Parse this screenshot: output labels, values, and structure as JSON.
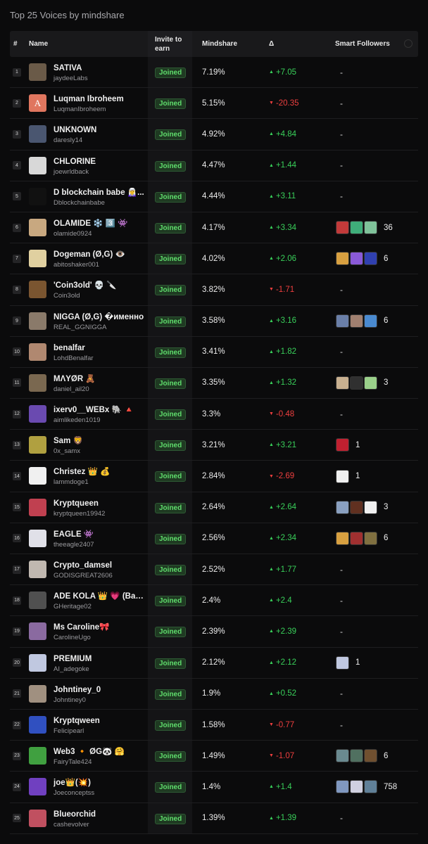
{
  "page_title": "Top 25 Voices by mindshare",
  "headers": {
    "rank": "#",
    "name": "Name",
    "invite": "Invite to earn",
    "mindshare": "Mindshare",
    "delta": "Δ",
    "smart": "Smart Followers"
  },
  "rows": [
    {
      "rank": "1",
      "name": "SATIVA",
      "handle": "jaydeeLabs",
      "status": "Joined",
      "mindshare": "7.19%",
      "delta": "+7.05",
      "dir": "up",
      "smart_count": "-",
      "sf_colors": [],
      "av": "#6a5a48"
    },
    {
      "rank": "2",
      "name": "Luqman Ibroheem",
      "handle": "LuqmanIbroheem",
      "status": "Joined",
      "mindshare": "5.15%",
      "delta": "-20.35",
      "dir": "down",
      "smart_count": "-",
      "sf_colors": [],
      "av": "#e0765f",
      "av_text": "A"
    },
    {
      "rank": "3",
      "name": "UNKNOWN",
      "handle": "daresly14",
      "status": "Joined",
      "mindshare": "4.92%",
      "delta": "+4.84",
      "dir": "up",
      "smart_count": "-",
      "sf_colors": [],
      "av": "#4a5670"
    },
    {
      "rank": "4",
      "name": "CHLORINE",
      "handle": "joewrldback",
      "status": "Joined",
      "mindshare": "4.47%",
      "delta": "+1.44",
      "dir": "up",
      "smart_count": "-",
      "sf_colors": [],
      "av": "#d8d8d8"
    },
    {
      "rank": "5",
      "name": "D blockchain babe 🧝‍♀️...",
      "handle": "Dblockchainbabe",
      "status": "Joined",
      "mindshare": "4.44%",
      "delta": "+3.11",
      "dir": "up",
      "smart_count": "-",
      "sf_colors": [],
      "av": "#111111"
    },
    {
      "rank": "6",
      "name": "OLAMIDE ❄️ 3️⃣ 👾",
      "handle": "olamide0924",
      "status": "Joined",
      "mindshare": "4.17%",
      "delta": "+3.34",
      "dir": "up",
      "smart_count": "36",
      "sf_colors": [
        "#c23a3a",
        "#3fae7a",
        "#7fc29a"
      ],
      "av": "#c8a880"
    },
    {
      "rank": "7",
      "name": "Dogeman (Ø,G) 👁️",
      "handle": "abitoshaker001",
      "status": "Joined",
      "mindshare": "4.02%",
      "delta": "+2.06",
      "dir": "up",
      "smart_count": "6",
      "sf_colors": [
        "#d8a040",
        "#8a5ad8",
        "#3040b0"
      ],
      "av": "#e0d0a0"
    },
    {
      "rank": "8",
      "name": "'Coin3old' 💀 🔪",
      "handle": "Coin3old",
      "status": "Joined",
      "mindshare": "3.82%",
      "delta": "-1.71",
      "dir": "down",
      "smart_count": "-",
      "sf_colors": [],
      "av": "#7a5530"
    },
    {
      "rank": "9",
      "name": "NIGGA (Ø,G) �именно",
      "handle": "REAL_GGNIGGA",
      "status": "Joined",
      "mindshare": "3.58%",
      "delta": "+3.16",
      "dir": "up",
      "smart_count": "6",
      "sf_colors": [
        "#6a7fa8",
        "#a08070",
        "#4a8ad0"
      ],
      "av": "#8a7a6a"
    },
    {
      "rank": "10",
      "name": "benalfar",
      "handle": "LohdBenalfar",
      "status": "Joined",
      "mindshare": "3.41%",
      "delta": "+1.82",
      "dir": "up",
      "smart_count": "-",
      "sf_colors": [],
      "av": "#b08870"
    },
    {
      "rank": "11",
      "name": "MΛYØR 🧸",
      "handle": "daniel_ail20",
      "status": "Joined",
      "mindshare": "3.35%",
      "delta": "+1.32",
      "dir": "up",
      "smart_count": "3",
      "sf_colors": [
        "#c8b090",
        "#303030",
        "#9ad08a"
      ],
      "av": "#7a6850"
    },
    {
      "rank": "12",
      "name": "ixerv0__WEBx 🐘 🔺",
      "handle": "aimlikeden1019",
      "status": "Joined",
      "mindshare": "3.3%",
      "delta": "-0.48",
      "dir": "down",
      "smart_count": "-",
      "sf_colors": [],
      "av": "#6a4ab0"
    },
    {
      "rank": "13",
      "name": "Sam 🦁",
      "handle": "0x_samx",
      "status": "Joined",
      "mindshare": "3.21%",
      "delta": "+3.21",
      "dir": "up",
      "smart_count": "1",
      "sf_colors": [
        "#c02030"
      ],
      "av": "#b0a040"
    },
    {
      "rank": "14",
      "name": "Christez 👑 💰",
      "handle": "lammdoge1",
      "status": "Joined",
      "mindshare": "2.84%",
      "delta": "-2.69",
      "dir": "down",
      "smart_count": "1",
      "sf_colors": [
        "#f0f0f0"
      ],
      "av": "#f0f0f0"
    },
    {
      "rank": "15",
      "name": "Kryptqueen",
      "handle": "kryptqueen19942",
      "status": "Joined",
      "mindshare": "2.64%",
      "delta": "+2.64",
      "dir": "up",
      "smart_count": "3",
      "sf_colors": [
        "#8aa0c0",
        "#603020",
        "#f0f0f0"
      ],
      "av": "#c04050"
    },
    {
      "rank": "16",
      "name": "EAGLE 👾",
      "handle": "theeagle2407",
      "status": "Joined",
      "mindshare": "2.56%",
      "delta": "+2.34",
      "dir": "up",
      "smart_count": "6",
      "sf_colors": [
        "#d8a040",
        "#a03030",
        "#807040"
      ],
      "av": "#e0e0e8"
    },
    {
      "rank": "17",
      "name": "Crypto_damsel",
      "handle": "GODISGREAT2606",
      "status": "Joined",
      "mindshare": "2.52%",
      "delta": "+1.77",
      "dir": "up",
      "smart_count": "-",
      "sf_colors": [],
      "av": "#c0b8b0"
    },
    {
      "rank": "18",
      "name": "ADE KOLA 👑 💗 (Bac...",
      "handle": "GHeritage02",
      "status": "Joined",
      "mindshare": "2.4%",
      "delta": "+2.4",
      "dir": "up",
      "smart_count": "-",
      "sf_colors": [],
      "av": "#505050"
    },
    {
      "rank": "19",
      "name": "Ms Caroline🎀",
      "handle": "CarolineUgo",
      "status": "Joined",
      "mindshare": "2.39%",
      "delta": "+2.39",
      "dir": "up",
      "smart_count": "-",
      "sf_colors": [],
      "av": "#8a6aa0"
    },
    {
      "rank": "20",
      "name": "PREMIUM",
      "handle": "AI_adegoke",
      "status": "Joined",
      "mindshare": "2.12%",
      "delta": "+2.12",
      "dir": "up",
      "smart_count": "1",
      "sf_colors": [
        "#c0c8e0"
      ],
      "av": "#c0c8e0"
    },
    {
      "rank": "21",
      "name": "Johntiney_0",
      "handle": "Johntiney0",
      "status": "Joined",
      "mindshare": "1.9%",
      "delta": "+0.52",
      "dir": "up",
      "smart_count": "-",
      "sf_colors": [],
      "av": "#a09080"
    },
    {
      "rank": "22",
      "name": "Kryptqween",
      "handle": "Felicipearl",
      "status": "Joined",
      "mindshare": "1.58%",
      "delta": "-0.77",
      "dir": "down",
      "smart_count": "-",
      "sf_colors": [],
      "av": "#3050c0"
    },
    {
      "rank": "23",
      "name": "Web3 🔸 ØG🐼 🤗",
      "handle": "FairyTale424",
      "status": "Joined",
      "mindshare": "1.49%",
      "delta": "-1.07",
      "dir": "down",
      "smart_count": "6",
      "sf_colors": [
        "#6a8a90",
        "#507060",
        "#705030"
      ],
      "av": "#40a040"
    },
    {
      "rank": "24",
      "name": "joe👑(💥)",
      "handle": "Joeconceptss",
      "status": "Joined",
      "mindshare": "1.4%",
      "delta": "+1.4",
      "dir": "up",
      "smart_count": "758",
      "sf_colors": [
        "#8098c0",
        "#d0d0e0",
        "#608098"
      ],
      "av": "#7040c0"
    },
    {
      "rank": "25",
      "name": "Blueorchid",
      "handle": "cashevolver",
      "status": "Joined",
      "mindshare": "1.39%",
      "delta": "+1.39",
      "dir": "up",
      "smart_count": "-",
      "sf_colors": [],
      "av": "#c05060"
    }
  ]
}
